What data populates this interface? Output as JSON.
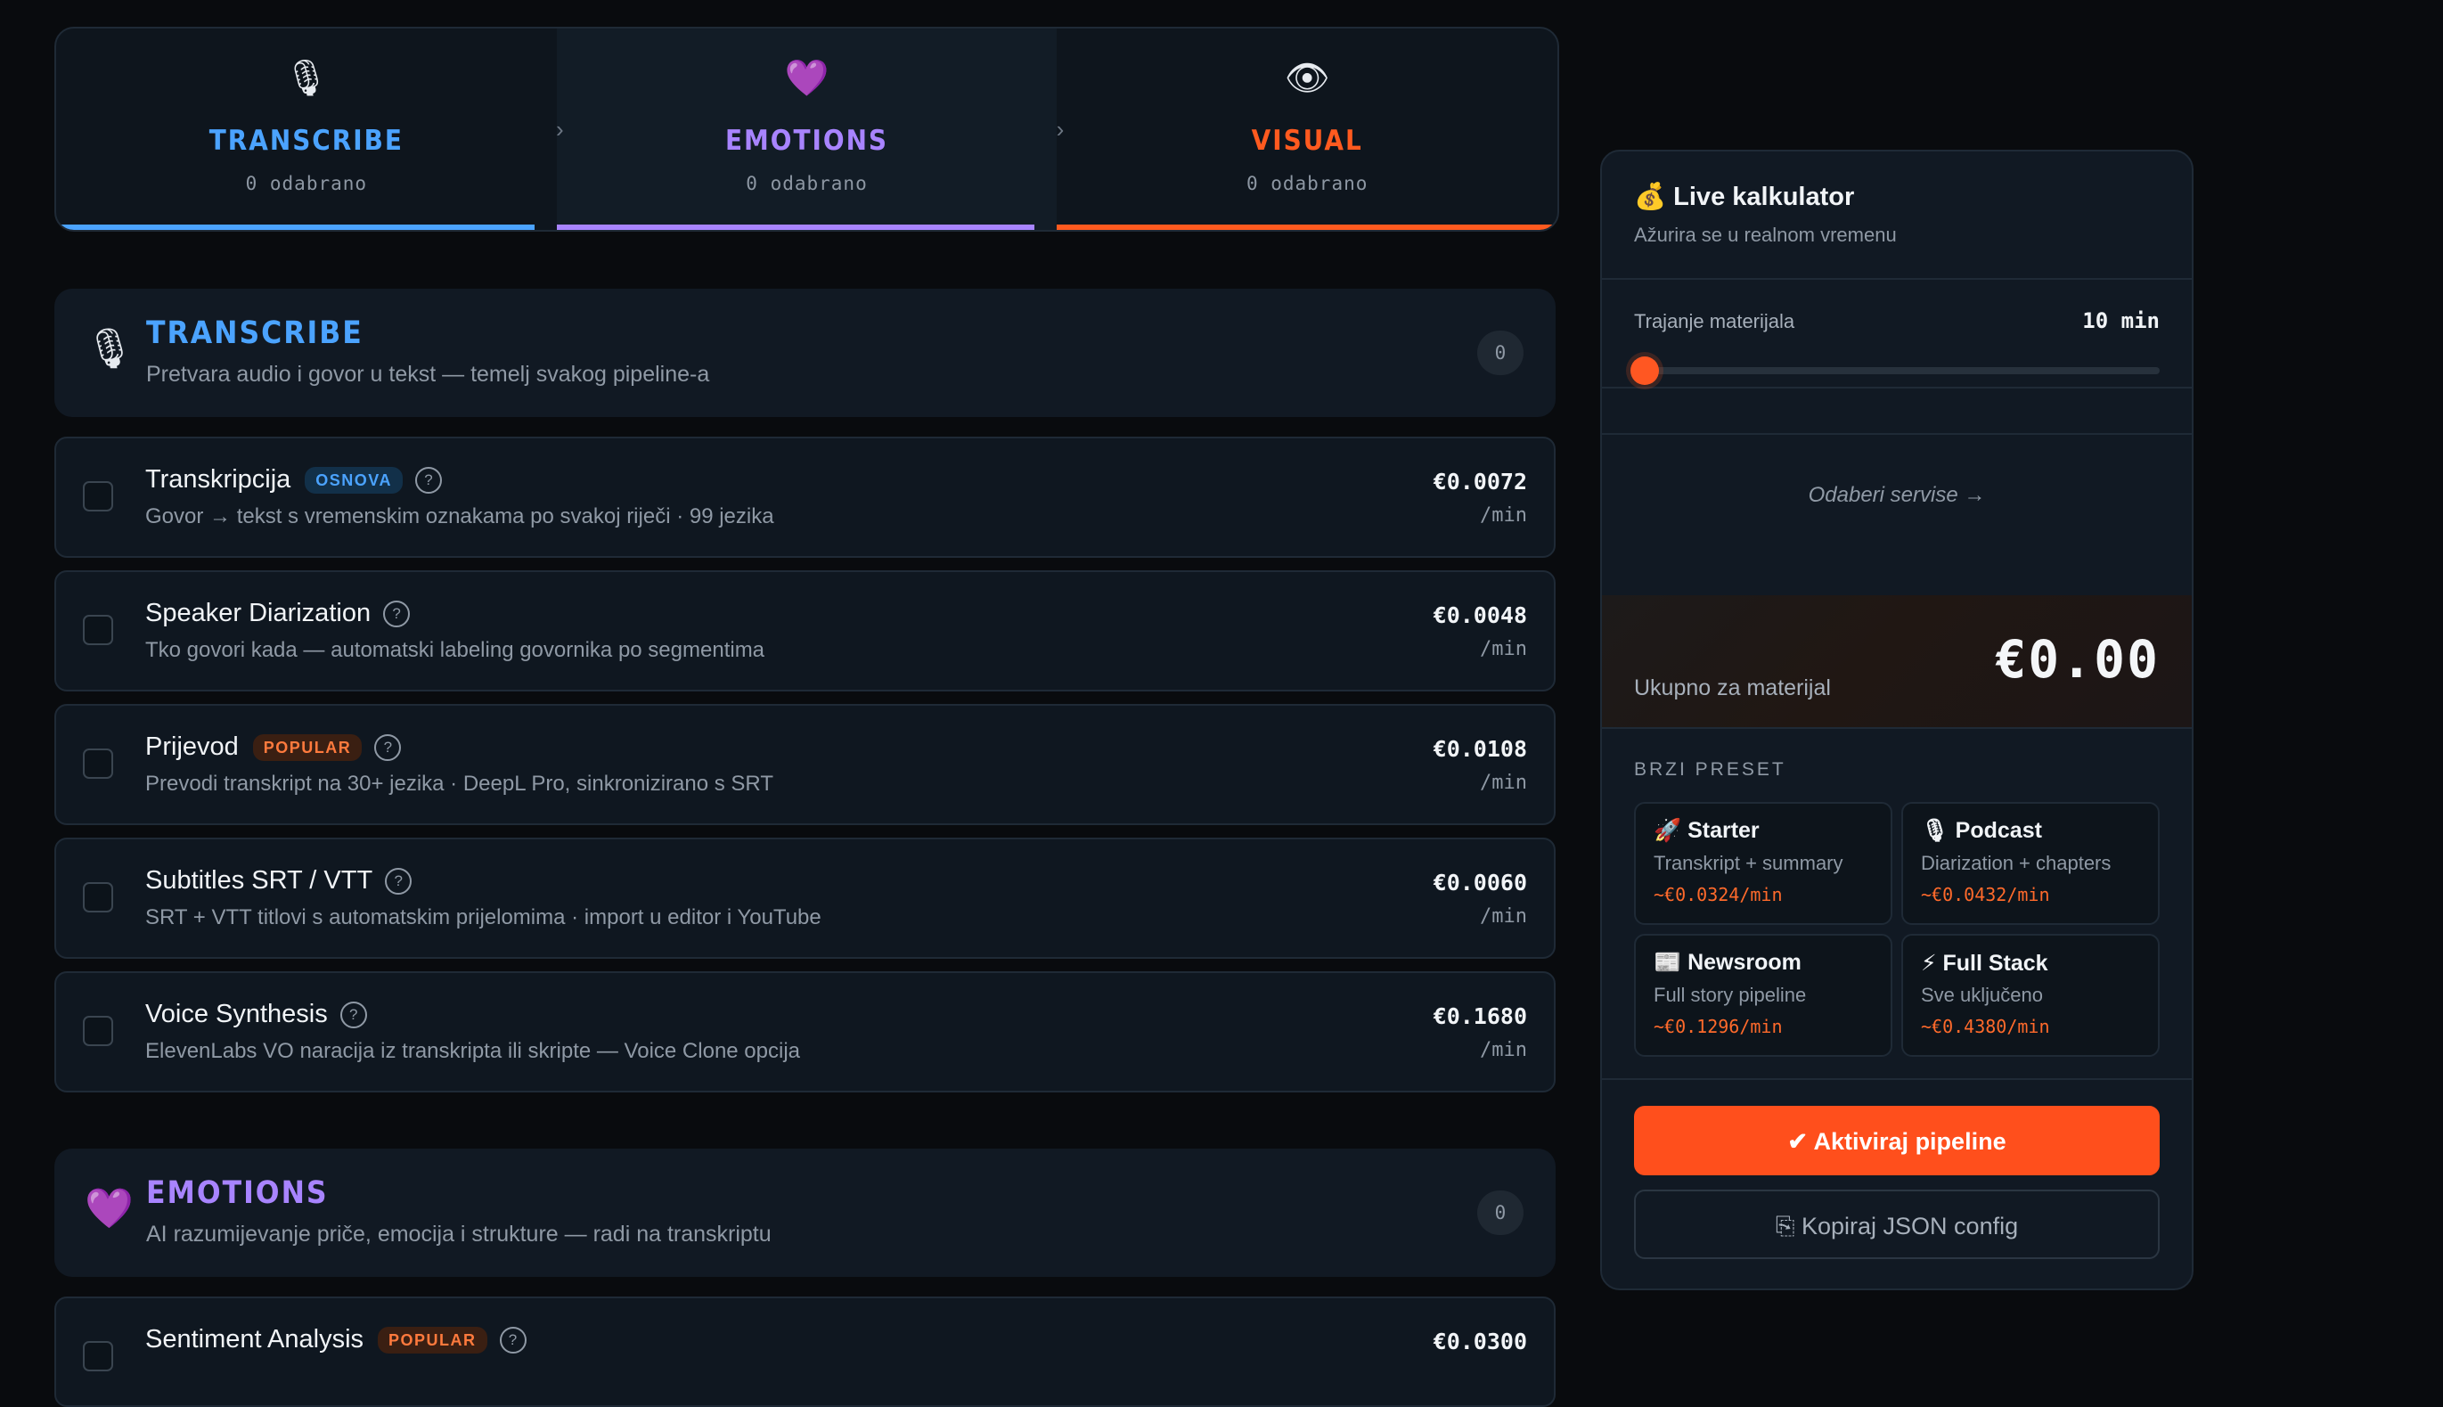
{
  "pipeline": {
    "steps": [
      {
        "icon": "🎙",
        "name": "TRANSCRIBE",
        "selected": "0 odabrano",
        "color": "#4ba3ff"
      },
      {
        "icon": "💜",
        "name": "EMOTIONS",
        "selected": "0 odabrano",
        "color": "#a884ff"
      },
      {
        "icon": "👁",
        "name": "VISUAL",
        "selected": "0 odabrano",
        "color": "#ff5a1f"
      }
    ],
    "arrow": "›"
  },
  "categories": {
    "transcribe": {
      "icon": "🎙",
      "title": "TRANSCRIBE",
      "description": "Pretvara audio i govor u tekst — temelj svakog pipeline-a",
      "count": "0"
    },
    "emotions": {
      "icon": "💜",
      "title": "EMOTIONS",
      "description": "AI razumijevanje priče, emocija i strukture — radi na transkriptu",
      "count": "0"
    }
  },
  "services": [
    {
      "name": "Transkripcija",
      "badge": "OSNOVA",
      "description": "Govor → tekst s vremenskim oznakama po svakoj riječi · 99 jezika",
      "price": "€0.0072",
      "unit": "/min"
    },
    {
      "name": "Speaker Diarization",
      "badge": "",
      "description": "Tko govori kada — automatski labeling govornika po segmentima",
      "price": "€0.0048",
      "unit": "/min"
    },
    {
      "name": "Prijevod",
      "badge": "POPULAR",
      "description": "Prevodi transkript na 30+ jezika · DeepL Pro, sinkronizirano s SRT",
      "price": "€0.0108",
      "unit": "/min"
    },
    {
      "name": "Subtitles SRT / VTT",
      "badge": "",
      "description": "SRT + VTT titlovi s automatskim prijelomima · import u editor i YouTube",
      "price": "€0.0060",
      "unit": "/min"
    },
    {
      "name": "Voice Synthesis",
      "badge": "",
      "description": "ElevenLabs VO naracija iz transkripta ili skripte — Voice Clone opcija",
      "price": "€0.1680",
      "unit": "/min"
    },
    {
      "name": "Sentiment Analysis",
      "badge": "POPULAR",
      "description": "",
      "price": "€0.0300",
      "unit": ""
    }
  ],
  "help_glyph": "?",
  "calculator": {
    "title": "💰 Live kalkulator",
    "subtitle": "Ažurira se u realnom vremenu",
    "duration_label": "Trajanje materijala",
    "duration_value": "10 min",
    "slider_fraction": 0.02,
    "empty_hint": "Odaberi servise →",
    "total_label": "Ukupno za materijal",
    "total_value": "€0.00",
    "preset_heading": "BRZI PRESET",
    "presets": [
      {
        "title": "🚀 Starter",
        "desc": "Transkript + summary",
        "price": "~€0.0324/min"
      },
      {
        "title": "🎙 Podcast",
        "desc": "Diarization + chapters",
        "price": "~€0.0432/min"
      },
      {
        "title": "📰 Newsroom",
        "desc": "Full story pipeline",
        "price": "~€0.1296/min"
      },
      {
        "title": "⚡ Full Stack",
        "desc": "Sve uključeno",
        "price": "~€0.4380/min"
      }
    ],
    "activate_label": "✔ Aktiviraj pipeline",
    "copy_label": "⎘ Kopiraj JSON config"
  },
  "colors": {
    "accent": "#ff4f1c",
    "transcribe": "#4ba3ff",
    "emotions": "#a884ff",
    "visual": "#ff5a1f"
  }
}
